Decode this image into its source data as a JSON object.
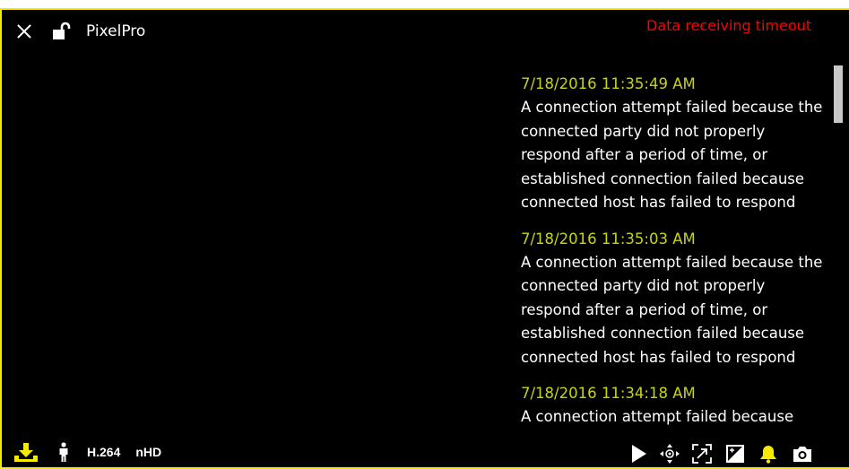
{
  "window": {
    "title": "PixelPro"
  },
  "status": {
    "text": "Data receiving timeout",
    "color": "#ff0000"
  },
  "log": {
    "entries": [
      {
        "time": "7/18/2016 11:35:49 AM",
        "message": "A connection attempt failed because the connected party did not properly respond after a period of time, or established connection failed because connected host has failed to respond"
      },
      {
        "time": "7/18/2016 11:35:03 AM",
        "message": "A connection attempt failed because the connected party did not properly respond after a period of time, or established connection failed because connected host has failed to respond"
      },
      {
        "time": "7/18/2016 11:34:18 AM",
        "message": "A connection attempt failed because"
      }
    ]
  },
  "stream": {
    "codec": "H.264",
    "resolution": "nHD"
  },
  "colors": {
    "accent": "#f5ea00",
    "timestamp": "#c7d414",
    "background": "#000000"
  },
  "icons": {
    "top": [
      "close-icon",
      "unlock-icon"
    ],
    "bottom_left": [
      "download-icon",
      "person-icon"
    ],
    "bottom_right": [
      "play-icon",
      "ptz-move-icon",
      "focus-icon",
      "image-adjust-icon",
      "alarm-bell-icon",
      "camera-icon"
    ]
  }
}
